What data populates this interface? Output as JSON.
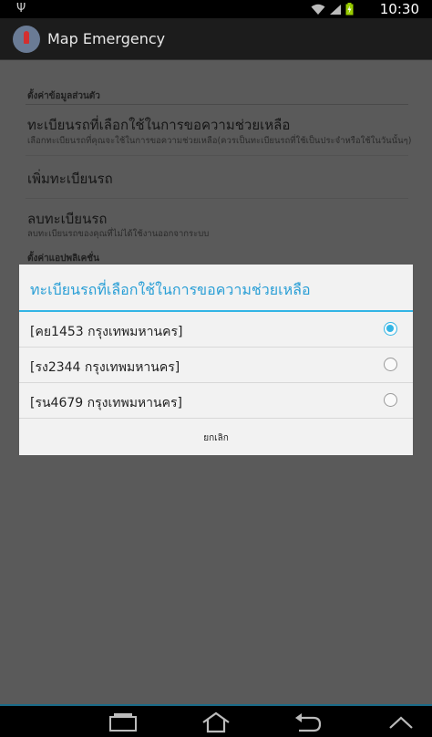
{
  "status_bar": {
    "usb_icon": "usb-icon",
    "wifi_icon": "wifi-icon",
    "signal_icon": "signal-icon",
    "battery_icon": "battery-charging-icon",
    "time": "10:30"
  },
  "app_bar": {
    "icon": "map-emergency-app-icon",
    "title": "Map Emergency"
  },
  "settings": {
    "category_personal": "ตั้งค่าข้อมูลส่วนตัว",
    "pref_select_plate": {
      "title": "ทะเบียนรถที่เลือกใช้ในการขอความช่วยเหลือ",
      "summary": "เลือกทะเบียนรถที่คุณจะใช้ในการขอความช่วยเหลือ(ควรเป็นทะเบียนรถที่ใช้เป็นประจำหรือใช้ในวันนั้นๆ)"
    },
    "pref_add_plate": {
      "title": "เพิ่มทะเบียนรถ"
    },
    "pref_remove_plate": {
      "title": "ลบทะเบียนรถ",
      "summary": "ลบทะเบียนรถของคุณที่ไม่ได้ใช้งานออกจากระบบ"
    },
    "category_app": "ตั้งค่าแอปพลิเคชั่น"
  },
  "dialog": {
    "title": "ทะเบียนรถที่เลือกใช้ในการขอความช่วยเหลือ",
    "options": [
      {
        "label": "[คย1453 กรุงเทพมหานคร]",
        "selected": true
      },
      {
        "label": "[รง2344 กรุงเทพมหานคร]",
        "selected": false
      },
      {
        "label": "[รน4679 กรุงเทพมหานคร]",
        "selected": false
      }
    ],
    "cancel_label": "ยกเลิก",
    "accent_color": "#33b5e5"
  },
  "nav_bar": {
    "recent_icon": "recent-apps-icon",
    "home_icon": "home-icon",
    "back_icon": "back-icon",
    "up_icon": "chevron-up-icon"
  }
}
